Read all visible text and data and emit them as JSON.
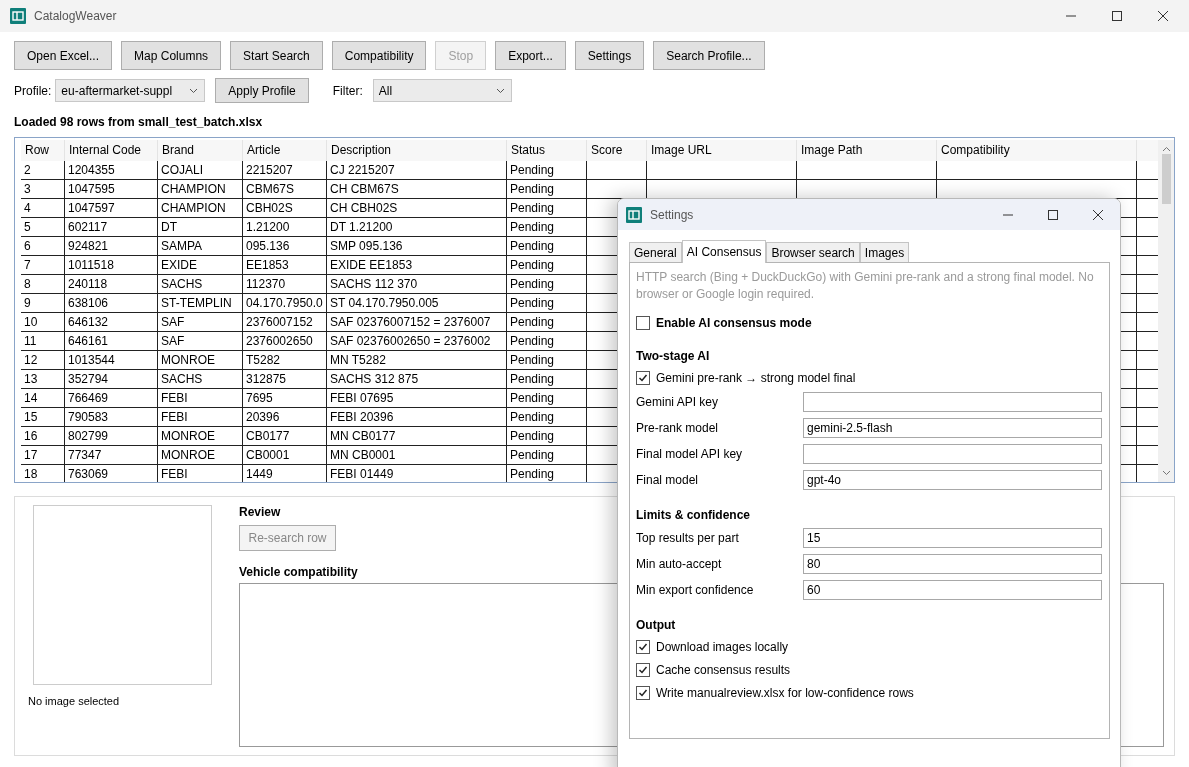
{
  "window": {
    "title": "CatalogWeaver"
  },
  "toolbar": [
    {
      "label": "Open Excel...",
      "disabled": false
    },
    {
      "label": "Map Columns",
      "disabled": false
    },
    {
      "label": "Start Search",
      "disabled": false
    },
    {
      "label": "Compatibility",
      "disabled": false
    },
    {
      "label": "Stop",
      "disabled": true
    },
    {
      "label": "Export...",
      "disabled": false
    },
    {
      "label": "Settings",
      "disabled": false
    },
    {
      "label": "Search Profile...",
      "disabled": false
    }
  ],
  "profile": {
    "label": "Profile:",
    "value": "eu-aftermarket-suppl"
  },
  "apply_button": "Apply Profile",
  "filter": {
    "label": "Filter:",
    "value": "All"
  },
  "status_text": "Loaded 98 rows from small_test_batch.xlsx",
  "table": {
    "columns": [
      "Row",
      "Internal Code",
      "Brand",
      "Article",
      "Description",
      "Status",
      "Score",
      "Image URL",
      "Image Path",
      "Compatibility"
    ],
    "rows": [
      [
        "2",
        "1204355",
        "COJALI",
        "2215207",
        "CJ 2215207",
        "Pending"
      ],
      [
        "3",
        "1047595",
        "CHAMPION",
        "CBM67S",
        "CH CBM67S",
        "Pending"
      ],
      [
        "4",
        "1047597",
        "CHAMPION",
        "CBH02S",
        "CH CBH02S",
        "Pending"
      ],
      [
        "5",
        "602117",
        "DT",
        "1.21200",
        "DT 1.21200",
        "Pending"
      ],
      [
        "6",
        "924821",
        "SAMPA",
        "095.136",
        "SMP 095.136",
        "Pending"
      ],
      [
        "7",
        "1011518",
        "EXIDE",
        "EE1853",
        "EXIDE EE1853",
        "Pending"
      ],
      [
        "8",
        "240118",
        "SACHS",
        "112370",
        "SACHS 112 370",
        "Pending"
      ],
      [
        "9",
        "638106",
        "ST-TEMPLIN",
        "04.170.7950.0",
        "ST 04.170.7950.005",
        "Pending"
      ],
      [
        "10",
        "646132",
        "SAF",
        "2376007152",
        "SAF 02376007152 = 2376007",
        "Pending"
      ],
      [
        "11",
        "646161",
        "SAF",
        "2376002650",
        "SAF 02376002650 = 2376002",
        "Pending"
      ],
      [
        "12",
        "1013544",
        "MONROE",
        "T5282",
        "MN T5282",
        "Pending"
      ],
      [
        "13",
        "352794",
        "SACHS",
        "312875",
        "SACHS 312 875",
        "Pending"
      ],
      [
        "14",
        "766469",
        "FEBI",
        "7695",
        "FEBI 07695",
        "Pending"
      ],
      [
        "15",
        "790583",
        "FEBI",
        "20396",
        "FEBI 20396",
        "Pending"
      ],
      [
        "16",
        "802799",
        "MONROE",
        "CB0177",
        "MN CB0177",
        "Pending"
      ],
      [
        "17",
        "77347",
        "MONROE",
        "CB0001",
        "MN CB0001",
        "Pending"
      ],
      [
        "18",
        "763069",
        "FEBI",
        "1449",
        "FEBI 01449",
        "Pending"
      ]
    ]
  },
  "image_caption": "No image selected",
  "review": {
    "heading": "Review",
    "button": {
      "label": "Re-search row",
      "disabled": true
    },
    "compat_heading": "Vehicle compatibility"
  },
  "settings": {
    "title": "Settings",
    "tabs": [
      {
        "label": "General",
        "selected": false
      },
      {
        "label": "AI Consensus",
        "selected": true
      },
      {
        "label": "Browser search",
        "selected": false
      },
      {
        "label": "Images",
        "selected": false
      }
    ],
    "description": "HTTP search (Bing + DuckDuckGo) with Gemini pre-rank and a strong final model. No browser or Google login required.",
    "items": [
      {
        "kind": "checkbox",
        "label": "Enable AI consensus mode",
        "checked": false,
        "strong": true
      },
      {
        "kind": "heading",
        "label": "Two-stage AI"
      },
      {
        "kind": "checkbox",
        "label": "Gemini pre-rank → strong model final",
        "checked": true,
        "strong": false
      },
      {
        "kind": "field",
        "label": "Gemini API key"
      },
      {
        "kind": "field",
        "label": "Pre-rank model",
        "value": "gemini-2.5-flash"
      },
      {
        "kind": "field",
        "label": "Final model API key"
      },
      {
        "kind": "field",
        "label": "Final model",
        "value": "gpt-4o"
      },
      {
        "kind": "heading",
        "label": "Limits & confidence"
      },
      {
        "kind": "field",
        "label": "Top results per part",
        "value": "15"
      },
      {
        "kind": "field",
        "label": "Min auto-accept",
        "value": "80"
      },
      {
        "kind": "field",
        "label": "Min export confidence",
        "value": "60"
      },
      {
        "kind": "heading",
        "label": "Output"
      },
      {
        "kind": "checkbox",
        "label": "Download images locally",
        "checked": true,
        "strong": false
      },
      {
        "kind": "checkbox",
        "label": "Cache consensus results",
        "checked": true,
        "strong": false
      },
      {
        "kind": "checkbox",
        "label": "Write manualreview.xlsx for low-confidence rows",
        "checked": true,
        "strong": false
      }
    ]
  }
}
